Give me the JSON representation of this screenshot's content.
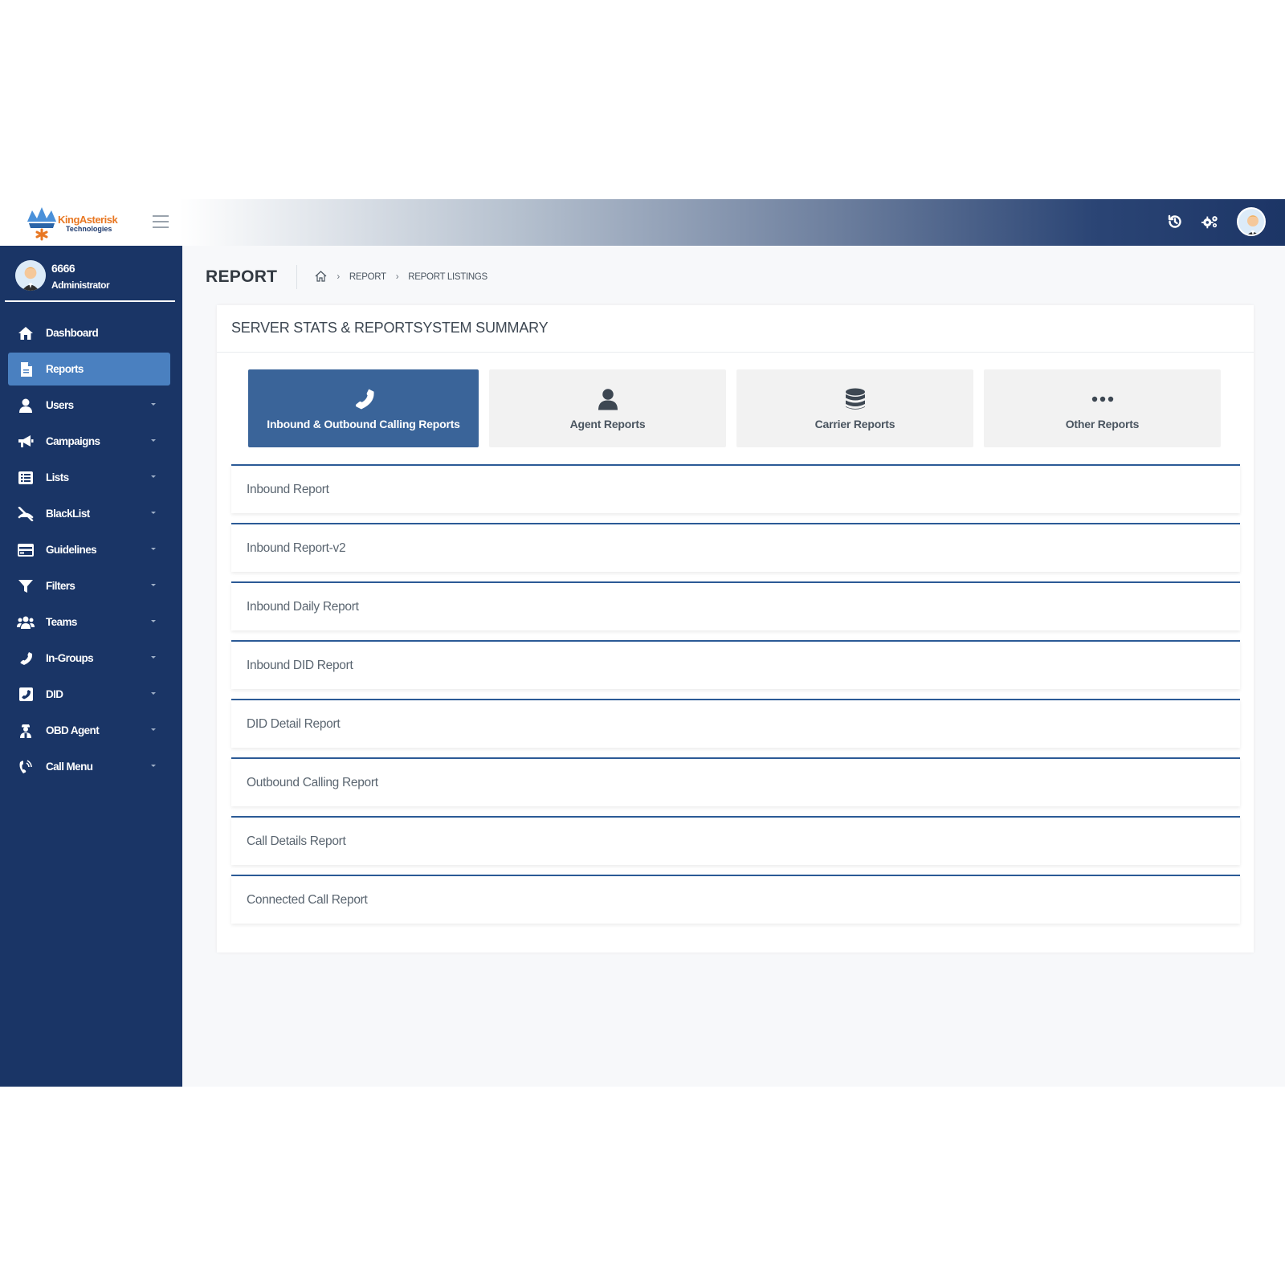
{
  "brand": {
    "name": "KingAsterisk",
    "sub": "Technologies"
  },
  "user": {
    "id": "6666",
    "role": "Administrator"
  },
  "sidebar": {
    "items": [
      {
        "label": "Dashboard",
        "icon": "home-icon",
        "active": false,
        "caret": false
      },
      {
        "label": "Reports",
        "icon": "file-icon",
        "active": true,
        "caret": false
      },
      {
        "label": "Users",
        "icon": "user-icon",
        "active": false,
        "caret": true
      },
      {
        "label": "Campaigns",
        "icon": "megaphone-icon",
        "active": false,
        "caret": true
      },
      {
        "label": "Lists",
        "icon": "list-icon",
        "active": false,
        "caret": true
      },
      {
        "label": "BlackList",
        "icon": "blocked-phone-icon",
        "active": false,
        "caret": true
      },
      {
        "label": "Guidelines",
        "icon": "credit-card-icon",
        "active": false,
        "caret": true
      },
      {
        "label": "Filters",
        "icon": "filter-icon",
        "active": false,
        "caret": true
      },
      {
        "label": "Teams",
        "icon": "users-icon",
        "active": false,
        "caret": true
      },
      {
        "label": "In-Groups",
        "icon": "phone-icon",
        "active": false,
        "caret": true
      },
      {
        "label": "DID",
        "icon": "phone-square-icon",
        "active": false,
        "caret": true
      },
      {
        "label": "OBD Agent",
        "icon": "agent-icon",
        "active": false,
        "caret": true
      },
      {
        "label": "Call Menu",
        "icon": "phone-volume-icon",
        "active": false,
        "caret": true
      }
    ]
  },
  "header": {
    "title": "REPORT",
    "breadcrumb": [
      "REPORT",
      "REPORT LISTINGS"
    ]
  },
  "card": {
    "title": "SERVER STATS & REPORTSYSTEM SUMMARY",
    "tabs": [
      {
        "label": "Inbound & Outbound Calling Reports",
        "icon": "phone-icon",
        "active": true
      },
      {
        "label": "Agent Reports",
        "icon": "user-icon",
        "active": false
      },
      {
        "label": "Carrier Reports",
        "icon": "database-icon",
        "active": false
      },
      {
        "label": "Other Reports",
        "icon": "ellipsis-icon",
        "active": false
      }
    ],
    "reports": [
      "Inbound Report",
      "Inbound Report-v2",
      "Inbound Daily Report",
      "Inbound DID Report",
      "DID Detail Report",
      "Outbound Calling Report",
      "Call Details Report",
      "Connected Call Report"
    ]
  },
  "colors": {
    "sidebar": "#1a3566",
    "active": "#4a80c0",
    "accent": "#3a6499"
  }
}
